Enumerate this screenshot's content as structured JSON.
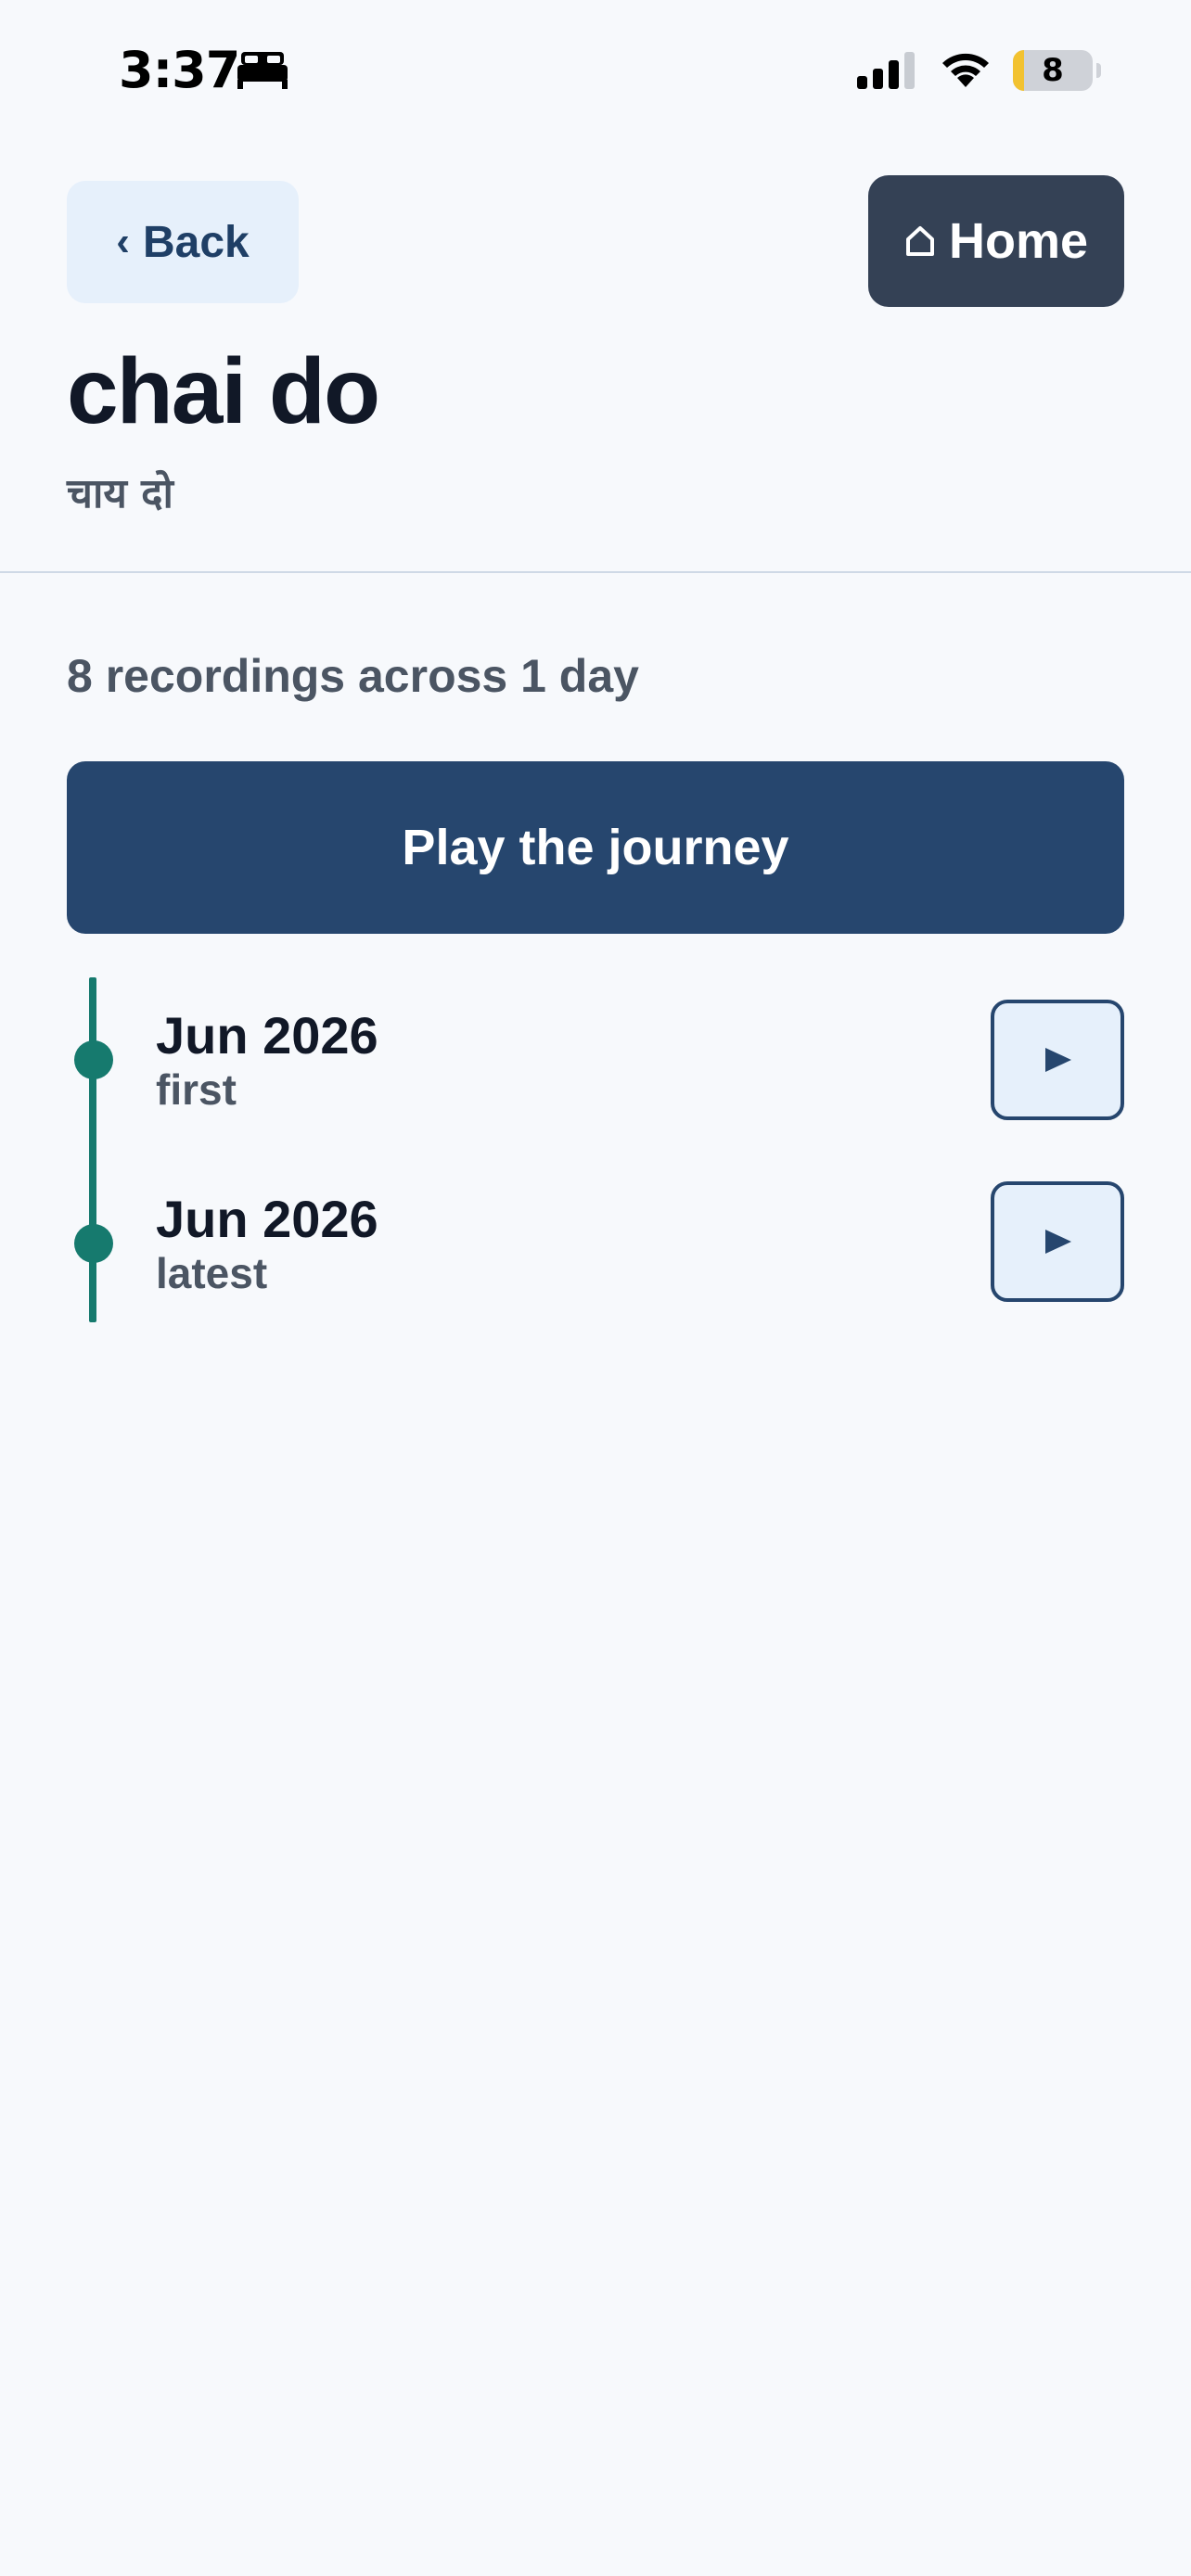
{
  "status_bar": {
    "time": "3:37",
    "battery": "8",
    "icons": [
      "sleep-icon",
      "signal-icon",
      "wifi-icon",
      "battery-icon"
    ]
  },
  "header": {
    "back_label": "Back",
    "home_label": "Home"
  },
  "word": {
    "title": "chai do",
    "translation": "चाय दो"
  },
  "summary": "8 recordings across 1 day",
  "play_journey_label": "Play the journey",
  "timeline": [
    {
      "date": "Jun 2026",
      "label": "first"
    },
    {
      "date": "Jun 2026",
      "label": "latest"
    }
  ],
  "colors": {
    "background": "#f7f9fc",
    "primary": "#26466e",
    "home_button": "#344155",
    "accent_timeline": "#167a6e",
    "soft_button": "#e6f0fb"
  }
}
